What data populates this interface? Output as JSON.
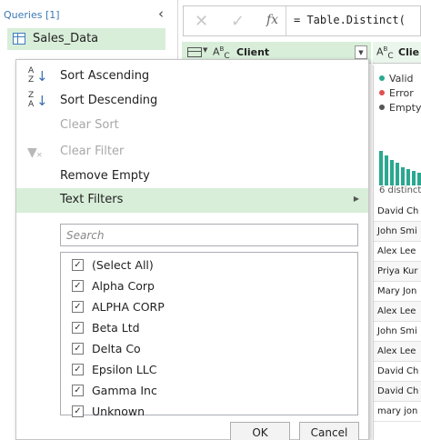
{
  "queries": {
    "header": "Queries [1]",
    "items": [
      {
        "label": "Sales_Data"
      }
    ]
  },
  "formula_bar": {
    "formula": "= Table.Distinct("
  },
  "columns": [
    {
      "type_label": "ABC",
      "name": "Client"
    },
    {
      "type_label": "ABC",
      "name": "Clie"
    }
  ],
  "profile": {
    "legend": [
      {
        "label": "Valid",
        "color": "#2aa890"
      },
      {
        "label": "Error",
        "color": "#e05050"
      },
      {
        "label": "Empty",
        "color": "#555555"
      }
    ],
    "histogram": [
      0.95,
      0.82,
      0.7,
      0.62,
      0.5,
      0.45,
      0.4,
      0.36
    ],
    "distinct_label": "6 distinct"
  },
  "data_rows": [
    "David Ch",
    "John Smi",
    "Alex Lee",
    "Priya Kur",
    "Mary Jon",
    "Alex Lee",
    "John Smi",
    "Alex Lee",
    "David Ch",
    "David Ch",
    "mary jon"
  ],
  "menu": {
    "sort_ascending": "Sort Ascending",
    "sort_descending": "Sort Descending",
    "clear_sort": "Clear Sort",
    "clear_filter": "Clear Filter",
    "remove_empty": "Remove Empty",
    "text_filters": "Text Filters",
    "search_placeholder": "Search",
    "checklist": [
      {
        "label": "(Select All)",
        "checked": true
      },
      {
        "label": "Alpha Corp",
        "checked": true
      },
      {
        "label": "ALPHA CORP",
        "checked": true
      },
      {
        "label": "Beta Ltd",
        "checked": true
      },
      {
        "label": "Delta Co",
        "checked": true
      },
      {
        "label": "Epsilon LLC",
        "checked": true
      },
      {
        "label": "Gamma Inc",
        "checked": true
      },
      {
        "label": "Unknown",
        "checked": true
      }
    ],
    "ok_label": "OK",
    "cancel_label": "Cancel"
  },
  "colors": {
    "accent_green": "#d8eed9",
    "valid": "#2aa890",
    "link_blue": "#3c78b4"
  }
}
